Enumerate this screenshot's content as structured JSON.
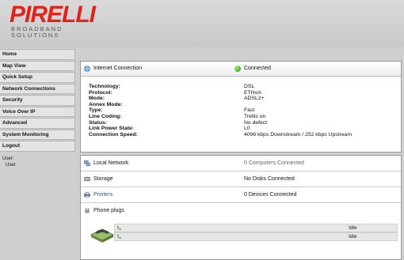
{
  "brand": {
    "logo_text": "PIRELLI",
    "sub_line1": "BROADBAND",
    "sub_line2": "SOLUTIONS",
    "red": "#e2231a"
  },
  "sidebar": {
    "items": [
      {
        "label": "Home"
      },
      {
        "label": "Map View"
      },
      {
        "label": "Quick Setup"
      },
      {
        "label": "Network Connections"
      },
      {
        "label": "Security"
      },
      {
        "label": "Voice Over IP"
      },
      {
        "label": "Advanced"
      },
      {
        "label": "System Monitoring"
      },
      {
        "label": "Logout"
      }
    ],
    "user_label": "User:",
    "user_value": "User"
  },
  "internet": {
    "title": "Internet Connection",
    "status": "Connected",
    "status_color": "#2d9b16",
    "fields": [
      {
        "label": "Technology:",
        "value": "DSL"
      },
      {
        "label": "Protocol:",
        "value": "ETHoA"
      },
      {
        "label": "Mode:",
        "value": "ADSL2+"
      },
      {
        "label": "Annex Mode:",
        "value": ""
      },
      {
        "label": "Type:",
        "value": "Fast"
      },
      {
        "label": "Line Coding:",
        "value": "Trellis on"
      },
      {
        "label": "Status:",
        "value": "No defect"
      },
      {
        "label": "Link Power State:",
        "value": "L0"
      },
      {
        "label": "Connection Speed:",
        "value": "4096 kbps Downstream / 252 kbps Upstream"
      }
    ]
  },
  "services": {
    "local_network": {
      "title": "Local Network",
      "value": "0 Computers Connected"
    },
    "storage": {
      "title": "Storage",
      "value": "No Disks Connected"
    },
    "printers": {
      "title": "Printers",
      "value": "0 Devices Connected"
    },
    "phone": {
      "title": "Phone plugs"
    },
    "plugs": [
      {
        "value": "Idle",
        "icon": "phone-handset-icon"
      },
      {
        "value": "Idle",
        "icon": "phone-handset-icon"
      }
    ]
  }
}
